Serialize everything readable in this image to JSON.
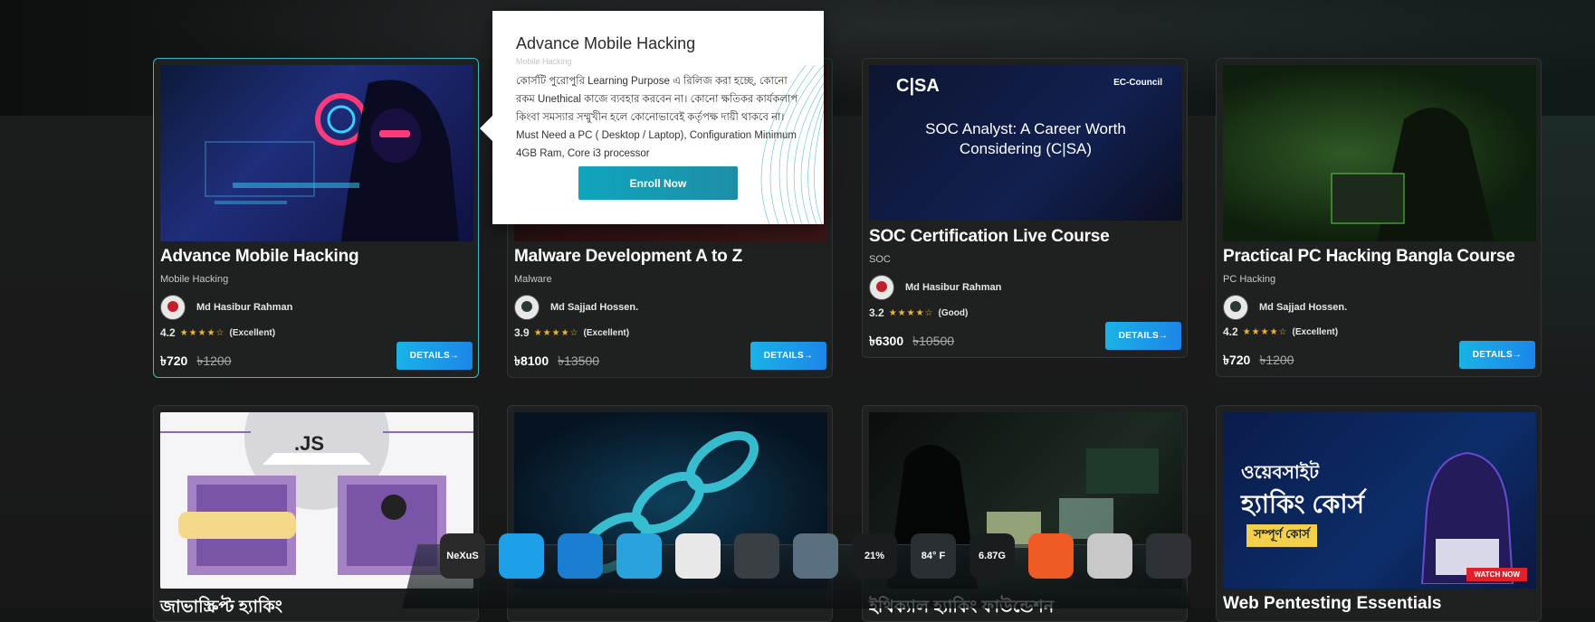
{
  "popup": {
    "title": "Advance Mobile Hacking",
    "category": "Mobile Hacking",
    "description": "কোর্সটি পুরোপুরি Learning Purpose এ রিলিজ করা হচ্ছে, কোনো রকম Unethical কাজে ব্যবহার করবেন না। কোনো ক্ষতিকর কার্যকলাপ কিংবা সমস্যার সম্মুখীন হলে কোনোভাবেই কর্তৃপক্ষ দায়ী থাকবে না। Must Need a PC ( Desktop / Laptop), Configuration Minimum 4GB Ram, Core i3 processor",
    "enroll_label": "Enroll Now"
  },
  "details_label": "DETAILS→",
  "courses_row1": [
    {
      "title": "Advance Mobile Hacking",
      "category": "Mobile Hacking",
      "author": "Md Hasibur Rahman",
      "rating": "4.2",
      "stars": "★★★★☆",
      "rating_label": "(Excellent)",
      "price": "৳720",
      "old_price": "৳1200"
    },
    {
      "title": "Malware Development A to Z",
      "category": "Malware",
      "author": "Md Sajjad Hossen.",
      "rating": "3.9",
      "stars": "★★★★☆",
      "rating_label": "(Excellent)",
      "price": "৳8100",
      "old_price": "৳13500"
    },
    {
      "title": "SOC Certification Live Course",
      "category": "SOC",
      "author": "Md Hasibur Rahman",
      "rating": "3.2",
      "stars": "★★★★☆",
      "rating_label": "(Good)",
      "price": "৳6300",
      "old_price": "৳10500"
    },
    {
      "title": "Practical PC Hacking Bangla Course",
      "category": "PC Hacking",
      "author": "Md Sajjad Hossen.",
      "rating": "4.2",
      "stars": "★★★★☆",
      "rating_label": "(Excellent)",
      "price": "৳720",
      "old_price": "৳1200"
    }
  ],
  "thumb_text": {
    "soc_logo": "C|SA",
    "soc_brand": "EC-Council",
    "soc_headline": "SOC Analyst: A Career Worth Considering (C|SA)",
    "js_label": ".JS",
    "web_line1": "ওয়েবসাইট",
    "web_line2": "হ্যাকিং কোর্স",
    "web_badge": "সম্পূর্ণ কোর্স",
    "web_watch": "WATCH NOW"
  },
  "row2_titles": [
    "জাভাস্ক্রিপ্ট হ্যাকিং",
    "",
    "ইথিক্যাল হ্যাকিং ফাউন্ডেশন",
    "Web Pentesting Essentials"
  ],
  "dock": {
    "items": [
      {
        "name": "nexus",
        "label": "NeXuS",
        "color": "#2a2a2a"
      },
      {
        "name": "windows",
        "label": "",
        "color": "#1ea0e8"
      },
      {
        "name": "vscode",
        "label": "",
        "color": "#1a7fd1"
      },
      {
        "name": "telegram",
        "label": "",
        "color": "#2aa3dd"
      },
      {
        "name": "chrome",
        "label": "",
        "color": "#e8e8e8"
      },
      {
        "name": "clock",
        "label": "",
        "color": "#3a3f44"
      },
      {
        "name": "recycle-bin",
        "label": "",
        "color": "#5a7080"
      },
      {
        "name": "cpu-meter",
        "label": "21%",
        "color": "#1a1d1f"
      },
      {
        "name": "weather",
        "label": "84° F",
        "color": "#2a2f33"
      },
      {
        "name": "ram-meter",
        "label": "6.87G",
        "color": "#1a1d1f"
      },
      {
        "name": "brave",
        "label": "",
        "color": "#f05a24"
      },
      {
        "name": "audio",
        "label": "",
        "color": "#c8c8c8"
      },
      {
        "name": "camera",
        "label": "",
        "color": "#2e3236"
      }
    ]
  }
}
